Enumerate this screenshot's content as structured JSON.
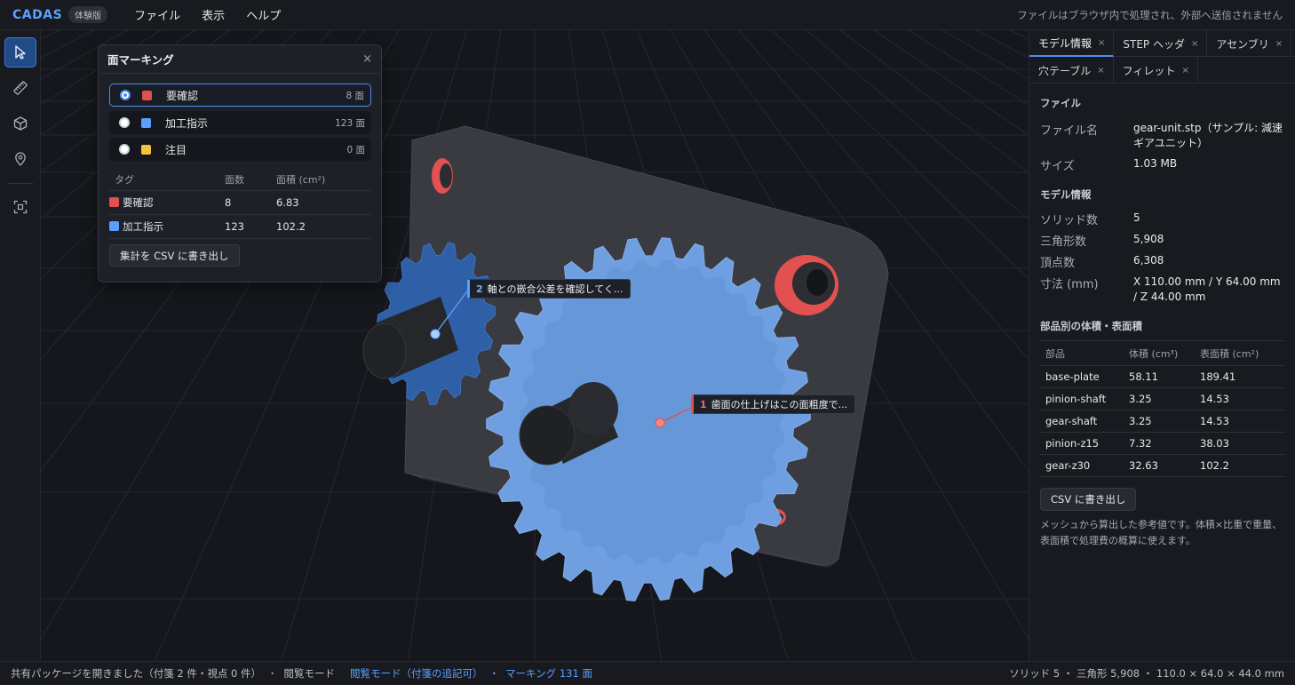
{
  "menubar": {
    "brand": "CADAS",
    "trial_badge": "体験版",
    "menus": [
      "ファイル",
      "表示",
      "ヘルプ"
    ],
    "privacy_notice": "ファイルはブラウザ内で処理され、外部へ送信されません"
  },
  "toolbar": {
    "tools": [
      {
        "name": "select-tool",
        "icon": "cursor-icon",
        "active": true
      },
      {
        "name": "measure-tool",
        "icon": "ruler-icon",
        "active": false
      },
      {
        "name": "face-tool",
        "icon": "cube-icon",
        "active": false
      },
      {
        "name": "pin-tool",
        "icon": "pin-icon",
        "active": false
      },
      {
        "name": "fit-view-tool",
        "icon": "focus-frame-icon",
        "active": false
      }
    ]
  },
  "marking_panel": {
    "title": "面マーキング",
    "close": "×",
    "options": [
      {
        "label": "要確認",
        "count": "8 面",
        "color": "#e2504f",
        "selected": true
      },
      {
        "label": "加工指示",
        "count": "123 面",
        "color": "#5aa0ff",
        "selected": false
      },
      {
        "label": "注目",
        "count": "0 面",
        "color": "#f2c33d",
        "selected": false
      }
    ],
    "table": {
      "headers": [
        "タグ",
        "面数",
        "面積 (cm²)"
      ],
      "rows": [
        {
          "tag": "要確認",
          "faces": "8",
          "area": "6.83",
          "color": "#e2504f"
        },
        {
          "tag": "加工指示",
          "faces": "123",
          "area": "102.2",
          "color": "#5aa0ff"
        }
      ]
    },
    "export_label": "集計を CSV に書き出し"
  },
  "callouts": [
    {
      "num": "1",
      "text": "歯面の仕上げはこの面粗度で..."
    },
    {
      "num": "2",
      "text": "軸との嵌合公差を確認してく..."
    }
  ],
  "right_panel": {
    "tabs_row1": [
      {
        "label": "モデル情報",
        "active": true
      },
      {
        "label": "STEP ヘッダ",
        "active": false
      },
      {
        "label": "アセンブリ",
        "active": false
      }
    ],
    "tabs_row2": [
      {
        "label": "穴テーブル",
        "active": false
      },
      {
        "label": "フィレット",
        "active": false
      }
    ],
    "tab_close": "×",
    "file_section": "ファイル",
    "file_name_key": "ファイル名",
    "file_name": "gear-unit.stp（サンプル: 減速ギアユニット）",
    "size_key": "サイズ",
    "size": "1.03 MB",
    "model_section": "モデル情報",
    "model_info": [
      {
        "key": "ソリッド数",
        "value": "5"
      },
      {
        "key": "三角形数",
        "value": "5,908"
      },
      {
        "key": "頂点数",
        "value": "6,308"
      },
      {
        "key": "寸法 (mm)",
        "value": "X 110.00 mm / Y 64.00 mm / Z 44.00 mm"
      }
    ],
    "parts_section": "部品別の体積・表面積",
    "parts_headers": [
      "部品",
      "体積 (cm³)",
      "表面積 (cm²)"
    ],
    "parts": [
      {
        "name": "base-plate",
        "volume": "58.11",
        "area": "189.41"
      },
      {
        "name": "pinion-shaft",
        "volume": "3.25",
        "area": "14.53"
      },
      {
        "name": "gear-shaft",
        "volume": "3.25",
        "area": "14.53"
      },
      {
        "name": "pinion-z15",
        "volume": "7.32",
        "area": "38.03"
      },
      {
        "name": "gear-z30",
        "volume": "32.63",
        "area": "102.2"
      }
    ],
    "csv_label": "CSV に書き出し",
    "note": "メッシュから算出した参考値です。体積×比重で重量、表面積で処理費の概算に使えます。"
  },
  "statusbar": {
    "message": "共有パッケージを開きました（付箋 2 件・視点 0 件）",
    "mode": "閲覧モード",
    "mode_detail": "閲覧モード（付箋の追記可）",
    "marking": "マーキング 131 面",
    "stats": "ソリッド 5 ・ 三角形 5,908 ・ 110.0 × 64.0 × 44.0 mm"
  },
  "colors": {
    "accent": "#4e8ef0",
    "gear_blue": "#6f9fe0",
    "mark_red": "#e2504f"
  }
}
